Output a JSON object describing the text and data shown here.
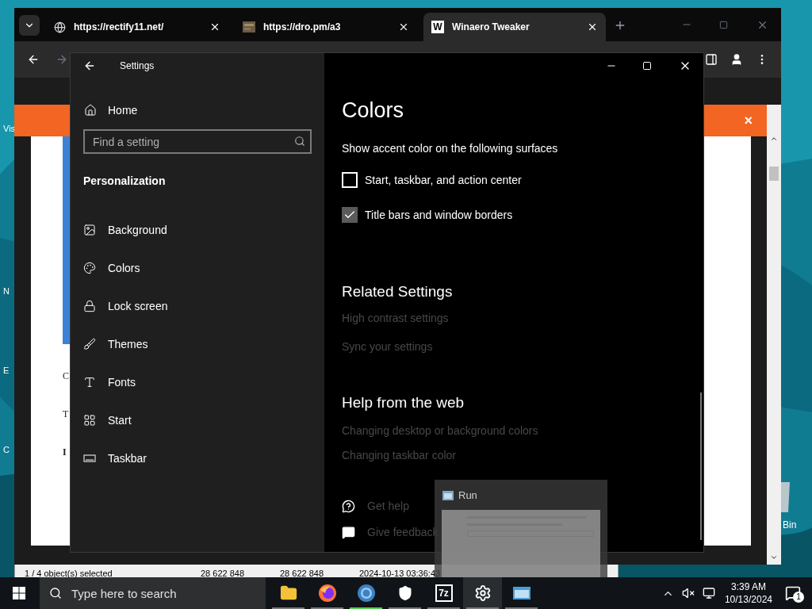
{
  "desktop": {
    "left_labels": [
      "Vis",
      "N",
      "E",
      "C"
    ],
    "right_label": "Bin"
  },
  "explorer_status": {
    "cells": [
      "1 / 4 object(s) selected",
      "28 622 848",
      "28 622 848",
      "2024-10-13 03:36:43"
    ]
  },
  "browser": {
    "tabs": [
      {
        "title": "https://rectify11.net/",
        "kind": "globe",
        "selected": false
      },
      {
        "title": "https://dro.pm/a3",
        "selected": false
      },
      {
        "title": "Winaero Tweaker",
        "kind": "letter",
        "badge": "W",
        "selected": true
      }
    ],
    "banner_close": "×",
    "page_fragments": [
      "C",
      "T",
      "I"
    ]
  },
  "settings": {
    "title": "Settings",
    "home": "Home",
    "search": {
      "placeholder": "Find a setting"
    },
    "section": "Personalization",
    "nav": [
      {
        "label": "Background",
        "kind": "background"
      },
      {
        "label": "Colors",
        "kind": "colors"
      },
      {
        "label": "Lock screen",
        "kind": "lock"
      },
      {
        "label": "Themes",
        "kind": "themes"
      },
      {
        "label": "Fonts",
        "kind": "fonts"
      },
      {
        "label": "Start",
        "kind": "start"
      },
      {
        "label": "Taskbar",
        "kind": "taskbar"
      }
    ],
    "heading": "Colors",
    "accent_label": "Show accent color on the following surfaces",
    "checkboxes": [
      {
        "label": "Start, taskbar, and action center",
        "checked": false
      },
      {
        "label": "Title bars and window borders",
        "checked": true
      }
    ],
    "related": {
      "title": "Related Settings",
      "links": [
        "High contrast settings",
        "Sync your settings"
      ]
    },
    "help": {
      "title": "Help from the web",
      "links": [
        "Changing desktop or background colors",
        "Changing taskbar color"
      ]
    },
    "actions": [
      {
        "label": "Get help",
        "kind": "help"
      },
      {
        "label": "Give feedback",
        "kind": "feedback"
      }
    ]
  },
  "run_preview": {
    "title": "Run"
  },
  "taskbar": {
    "search_placeholder": "Type here to search",
    "apps": [
      {
        "kind": "folder",
        "active": false
      },
      {
        "kind": "firefox",
        "active": false
      },
      {
        "kind": "chrome",
        "active": true
      },
      {
        "kind": "shield",
        "active": false
      },
      {
        "kind": "sevenzip",
        "label": "7z",
        "active": false
      },
      {
        "kind": "gear",
        "active": false
      },
      {
        "kind": "run",
        "active": false
      }
    ],
    "time": "3:39 AM",
    "date": "10/13/2024",
    "notifications": "1"
  }
}
